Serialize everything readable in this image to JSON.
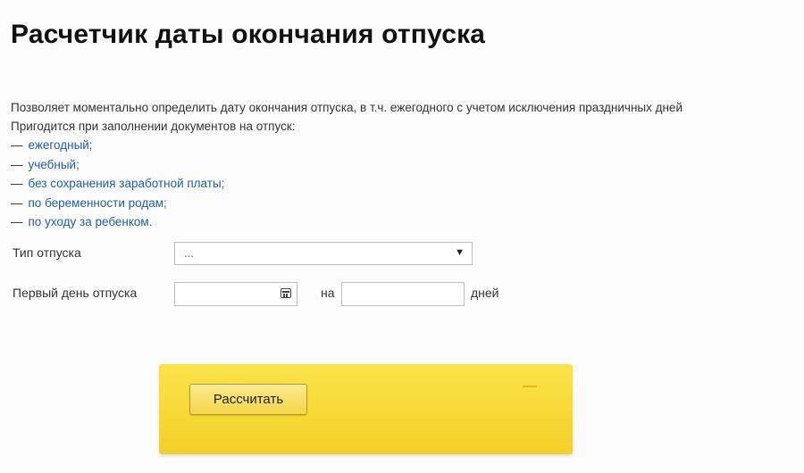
{
  "header": {
    "title": "Расчетчик даты окончания отпуска"
  },
  "intro": {
    "line1": "Позволяет моментально определить дату окончания отпуска, в т.ч. ежегодного с учетом исключения праздничных дней",
    "line2": "Пригодится при заполнении документов на отпуск:"
  },
  "leave_types": {
    "dash": "—",
    "items": [
      "ежегодный;",
      "учебный;",
      "без сохранения заработной платы;",
      "по беременности родам;",
      "по уходу за ребенком."
    ]
  },
  "form": {
    "type_label": "Тип отпуска",
    "type_value": "...",
    "type_arrow": "▼",
    "first_day_label": "Первый день отпуска",
    "first_day_value": "",
    "for_label": "на",
    "days_value": "",
    "days_label": "дней"
  },
  "actions": {
    "calculate_label": "Рассчитать"
  },
  "colors": {
    "panel": "#f7d936",
    "link": "#1d5fa8"
  }
}
